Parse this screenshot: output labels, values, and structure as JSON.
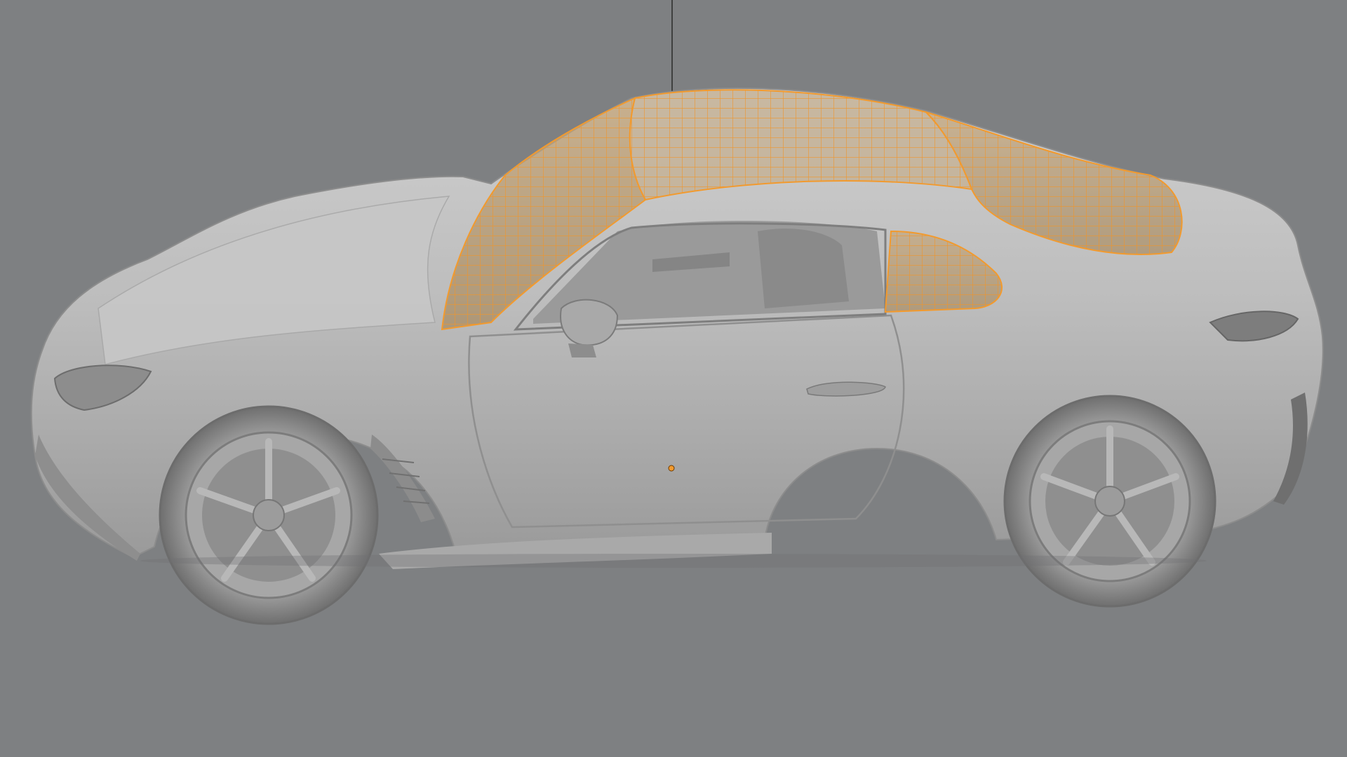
{
  "app": {
    "view": "3D Viewport",
    "shading": "solid",
    "background_color": "#7e8082"
  },
  "scene": {
    "object": "car-body",
    "selected_parts": [
      "front-windshield",
      "roof",
      "rear-window",
      "side-quarter-window"
    ],
    "selection_color": "#f29a2e",
    "body_color": "#b9b9b9",
    "origin_color": "#f29a2e"
  }
}
